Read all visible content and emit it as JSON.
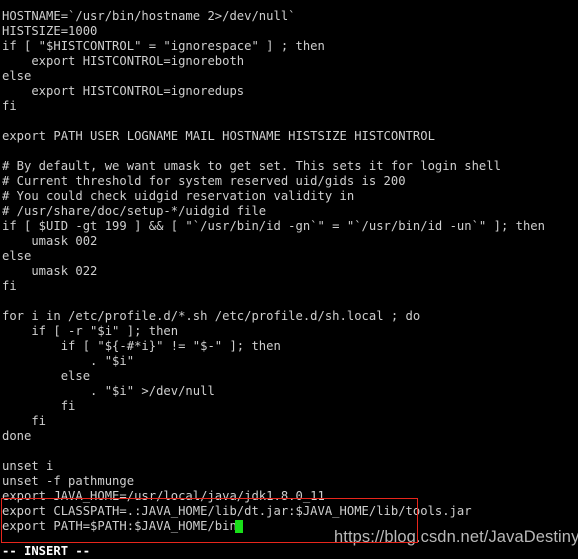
{
  "app": {
    "name": "vi",
    "mode_label": "-- INSERT --",
    "background_color": "#000000",
    "foreground_color": "#cfcfcf",
    "cursor_color": "#19e019",
    "annotation_color": "#e8261c"
  },
  "editor": {
    "lines": [
      "HOSTNAME=`/usr/bin/hostname 2>/dev/null`",
      "HISTSIZE=1000",
      "if [ \"$HISTCONTROL\" = \"ignorespace\" ] ; then",
      "    export HISTCONTROL=ignoreboth",
      "else",
      "    export HISTCONTROL=ignoredups",
      "fi",
      "",
      "export PATH USER LOGNAME MAIL HOSTNAME HISTSIZE HISTCONTROL",
      "",
      "# By default, we want umask to get set. This sets it for login shell",
      "# Current threshold for system reserved uid/gids is 200",
      "# You could check uidgid reservation validity in",
      "# /usr/share/doc/setup-*/uidgid file",
      "if [ $UID -gt 199 ] && [ \"`/usr/bin/id -gn`\" = \"`/usr/bin/id -un`\" ]; then",
      "    umask 002",
      "else",
      "    umask 022",
      "fi",
      "",
      "for i in /etc/profile.d/*.sh /etc/profile.d/sh.local ; do",
      "    if [ -r \"$i\" ]; then",
      "        if [ \"${-#*i}\" != \"$-\" ]; then",
      "            . \"$i\"",
      "        else",
      "            . \"$i\" >/dev/null",
      "        fi",
      "    fi",
      "done",
      "",
      "unset i",
      "unset -f pathmunge",
      "export JAVA_HOME=/usr/local/java/jdk1.8.0_11",
      "export CLASSPATH=.:JAVA_HOME/lib/dt.jar:$JAVA_HOME/lib/tools.jar",
      "export PATH=$PATH:$JAVA_HOME/bin"
    ]
  },
  "annotation": {
    "highlight_note": "red rectangle around the three java export lines",
    "highlighted_line_indices": [
      32,
      33,
      34
    ]
  },
  "cursor": {
    "line_index": 34,
    "column": 31
  },
  "watermark": {
    "text": "https://blog.csdn.net/JavaDestiny"
  }
}
